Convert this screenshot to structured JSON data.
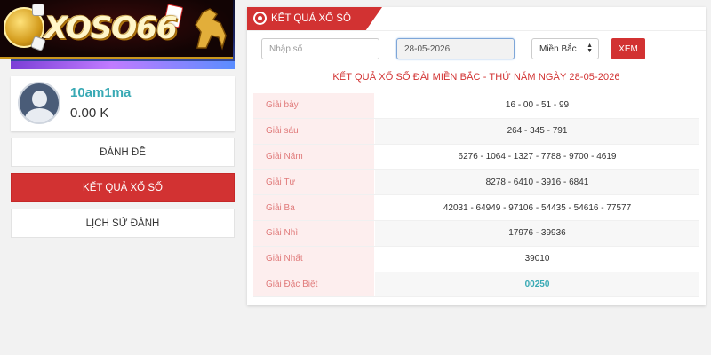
{
  "brand": {
    "logo_text": "XOSO66"
  },
  "user": {
    "name": "10am1ma",
    "balance": "0.00 K"
  },
  "menu": [
    {
      "label": "ĐÁNH ĐỀ",
      "active": false
    },
    {
      "label": "KẾT QUẢ XỔ SỐ",
      "active": true
    },
    {
      "label": "LỊCH SỬ ĐÁNH",
      "active": false
    }
  ],
  "panel": {
    "title": "KẾT QUẢ XỔ SỐ"
  },
  "filters": {
    "number_placeholder": "Nhập số",
    "date_value": "28-05-2026",
    "region_selected": "Miền Bắc",
    "submit_label": "XEM"
  },
  "result_title": "KẾT QUẢ XỔ SỐ ĐÀI MIỀN BẮC - THỨ NĂM NGÀY 28-05-2026",
  "prizes": [
    {
      "name": "Giải bảy",
      "value": "16 - 00 - 51 - 99"
    },
    {
      "name": "Giải sáu",
      "value": "264 - 345 - 791"
    },
    {
      "name": "Giải Năm",
      "value": "6276 - 1064 - 1327 - 7788 - 9700 - 4619"
    },
    {
      "name": "Giải Tư",
      "value": "8278 - 6410 - 3916 - 6841"
    },
    {
      "name": "Giải Ba",
      "value": "42031 - 64949 - 97106 - 54435 - 54616 - 77577"
    },
    {
      "name": "Giải Nhì",
      "value": "17976 - 39936"
    },
    {
      "name": "Giải Nhất",
      "value": "39010"
    },
    {
      "name": "Giải Đặc Biệt",
      "value": "00250"
    }
  ],
  "colors": {
    "accent": "#d23232",
    "teal": "#38a9b4"
  }
}
